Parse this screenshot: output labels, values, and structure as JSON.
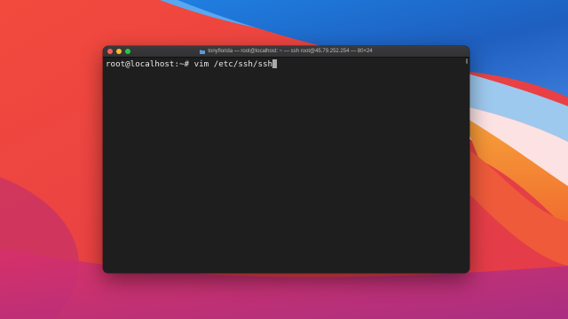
{
  "window": {
    "title": "tonyflorida — root@localhost: ~ — ssh root@45.79.252.254 — 80×24",
    "folder_icon": "folder-icon"
  },
  "terminal": {
    "prompt": "root@localhost:~# ",
    "command": "vim /etc/ssh/ssh"
  },
  "colors": {
    "terminal_bg": "#1e1e1e",
    "close": "#fe5f57",
    "minimize": "#febc2e",
    "zoom": "#28c840"
  }
}
